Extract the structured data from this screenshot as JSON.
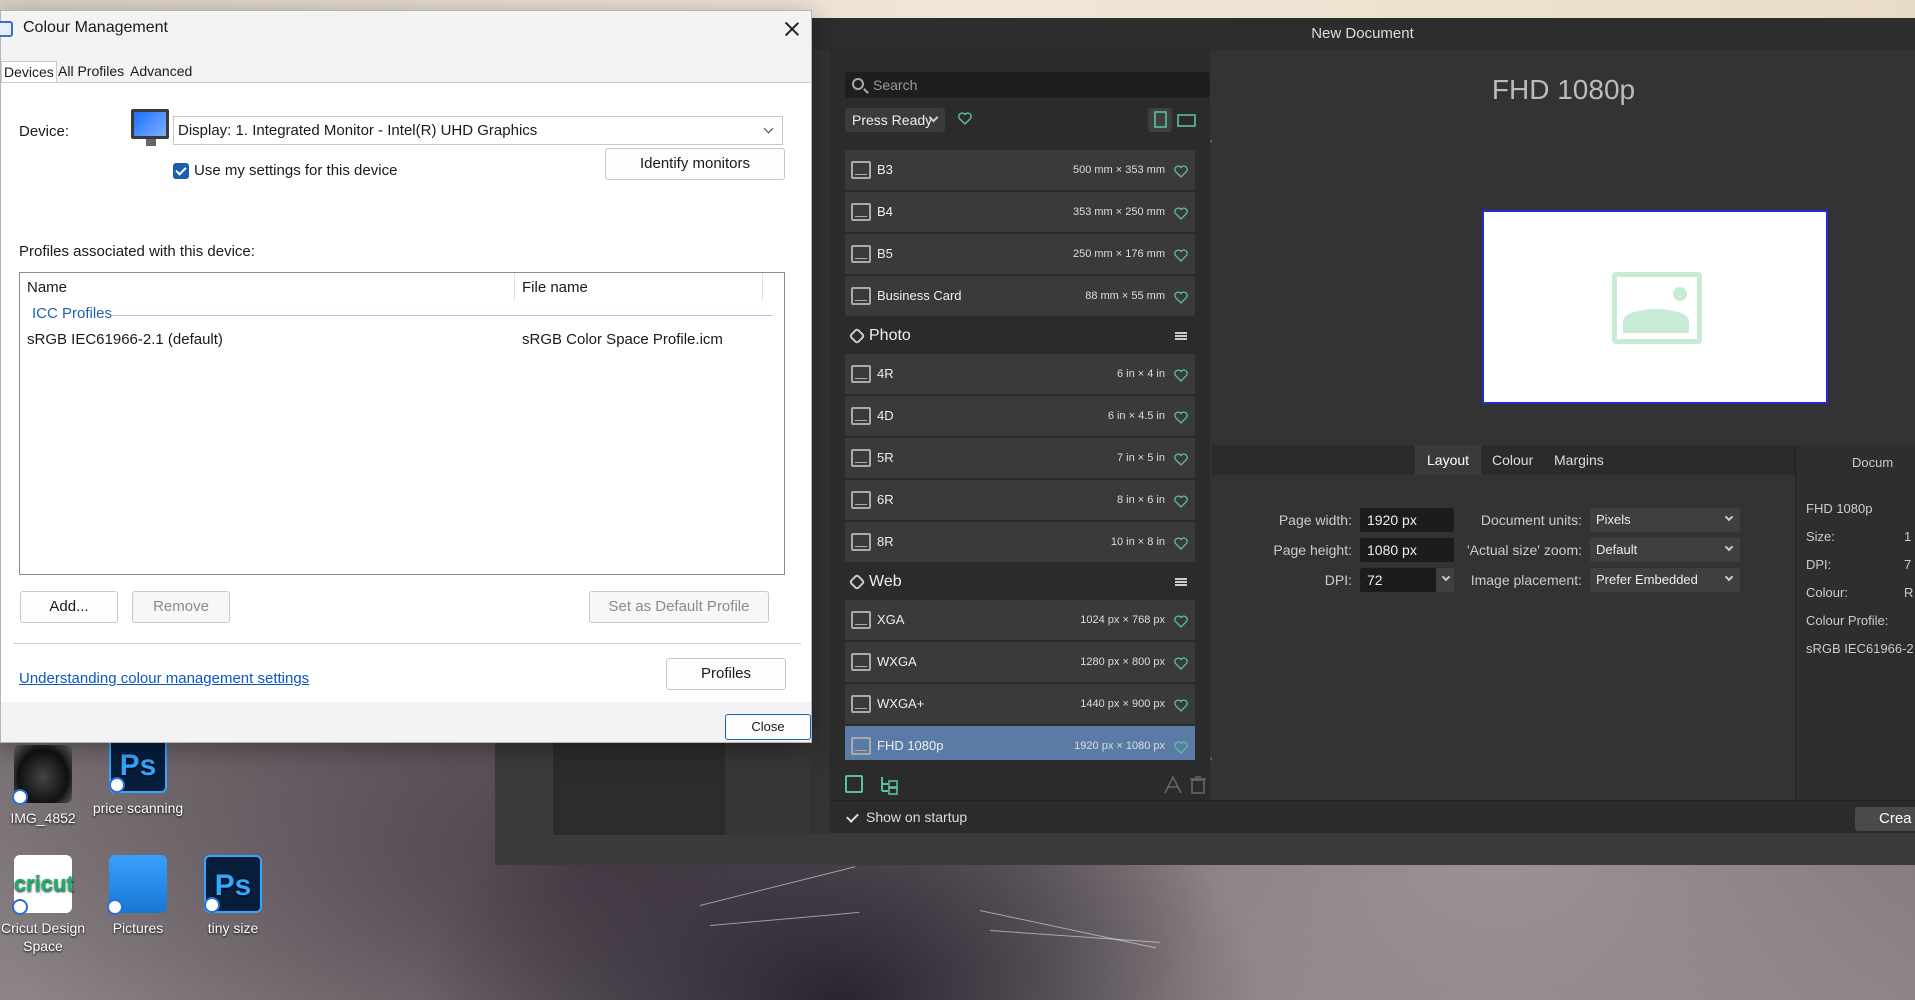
{
  "desktop": {
    "icons": [
      {
        "label": "IMG_4852"
      },
      {
        "label": "price scanning",
        "glyph": "Ps"
      },
      {
        "label": "Cricut Design Space",
        "glyph": "cricut"
      },
      {
        "label": "Pictures"
      },
      {
        "label": "tiny size",
        "glyph": "Ps"
      }
    ]
  },
  "colour_management": {
    "title": "Colour Management",
    "tabs": [
      "Devices",
      "All Profiles",
      "Advanced"
    ],
    "device_label": "Device:",
    "device_value": "Display: 1. Integrated Monitor - Intel(R) UHD Graphics",
    "use_settings_label": "Use my settings for this device",
    "identify_button": "Identify monitors",
    "profiles_heading": "Profiles associated with this device:",
    "columns": [
      "Name",
      "File name"
    ],
    "group_label": "ICC Profiles",
    "profiles": [
      {
        "name": "sRGB IEC61966-2.1 (default)",
        "file": "sRGB Color Space Profile.icm"
      }
    ],
    "add_button": "Add...",
    "remove_button": "Remove",
    "set_default_button": "Set as Default Profile",
    "help_link": "Understanding colour management settings",
    "profiles_button": "Profiles",
    "close_button": "Close"
  },
  "new_document": {
    "title": "New Document",
    "search_placeholder": "Search",
    "category_select": "Press Ready",
    "presets_top": [
      {
        "name": "B3",
        "size": "500 mm × 353 mm"
      },
      {
        "name": "B4",
        "size": "353 mm × 250 mm"
      },
      {
        "name": "B5",
        "size": "250 mm × 176 mm"
      },
      {
        "name": "Business Card",
        "size": "88 mm × 55 mm"
      }
    ],
    "category_photo": "Photo",
    "presets_photo": [
      {
        "name": "4R",
        "size": "6 in × 4 in"
      },
      {
        "name": "4D",
        "size": "6 in × 4.5 in"
      },
      {
        "name": "5R",
        "size": "7 in × 5 in"
      },
      {
        "name": "6R",
        "size": "8 in × 6 in"
      },
      {
        "name": "8R",
        "size": "10 in × 8 in"
      }
    ],
    "category_web": "Web",
    "presets_web": [
      {
        "name": "XGA",
        "size": "1024 px × 768 px"
      },
      {
        "name": "WXGA",
        "size": "1280 px × 800 px"
      },
      {
        "name": "WXGA+",
        "size": "1440 px × 900 px"
      },
      {
        "name": "FHD 1080p",
        "size": "1920 px × 1080 px"
      }
    ],
    "preview_title": "FHD 1080p",
    "settings_tabs": [
      "Layout",
      "Colour",
      "Margins"
    ],
    "page_width_label": "Page width:",
    "page_width": "1920 px",
    "page_height_label": "Page height:",
    "page_height": "1080 px",
    "dpi_label": "DPI:",
    "dpi": "72",
    "units_label": "Document units:",
    "units": "Pixels",
    "zoom_label": "'Actual size' zoom:",
    "zoom": "Default",
    "placement_label": "Image placement:",
    "placement": "Prefer Embedded",
    "info_heading": "Docum",
    "info_name": "FHD 1080p",
    "info_size_label": "Size:",
    "info_size_value": "1",
    "info_dpi_label": "DPI:",
    "info_dpi_value": "7",
    "info_colour_label": "Colour:",
    "info_colour_value": "R",
    "info_profile_label": "Colour Profile:",
    "info_profile_value": "sRGB IEC61966-2",
    "show_on_startup": "Show on startup",
    "create_button": "Crea"
  }
}
